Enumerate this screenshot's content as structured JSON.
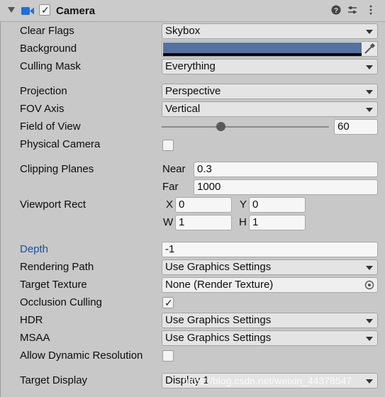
{
  "component": {
    "title": "Camera",
    "icons": [
      "foldout-arrow-icon",
      "camera-icon",
      "enabled-checkbox",
      "help-icon",
      "preset-icon",
      "more-options-icon"
    ]
  },
  "fields": {
    "clear_flags": {
      "label": "Clear Flags",
      "value": "Skybox"
    },
    "background": {
      "label": "Background",
      "color": "#5670a0"
    },
    "culling_mask": {
      "label": "Culling Mask",
      "value": "Everything"
    },
    "projection": {
      "label": "Projection",
      "value": "Perspective"
    },
    "fov_axis": {
      "label": "FOV Axis",
      "value": "Vertical"
    },
    "field_of_view": {
      "label": "Field of View",
      "value": "60",
      "slider_fraction": 0.35
    },
    "physical_camera": {
      "label": "Physical Camera",
      "checked": false
    },
    "clipping_planes": {
      "label": "Clipping Planes",
      "near_label": "Near",
      "near": "0.3",
      "far_label": "Far",
      "far": "1000"
    },
    "viewport_rect": {
      "label": "Viewport Rect",
      "x_label": "X",
      "x": "0",
      "y_label": "Y",
      "y": "0",
      "w_label": "W",
      "w": "1",
      "h_label": "H",
      "h": "1"
    },
    "depth": {
      "label": "Depth",
      "value": "-1"
    },
    "rendering_path": {
      "label": "Rendering Path",
      "value": "Use Graphics Settings"
    },
    "target_texture": {
      "label": "Target Texture",
      "value": "None (Render Texture)"
    },
    "occlusion_culling": {
      "label": "Occlusion Culling",
      "checked": true,
      "mark": "✓"
    },
    "hdr": {
      "label": "HDR",
      "value": "Use Graphics Settings"
    },
    "msaa": {
      "label": "MSAA",
      "value": "Use Graphics Settings"
    },
    "allow_dynamic_resolution": {
      "label": "Allow Dynamic Resolution",
      "checked": false
    },
    "target_display": {
      "label": "Target Display",
      "value": "Display 1"
    }
  },
  "header_check": "✓",
  "watermark": "https://blog.csdn.net/weixin_44378547"
}
